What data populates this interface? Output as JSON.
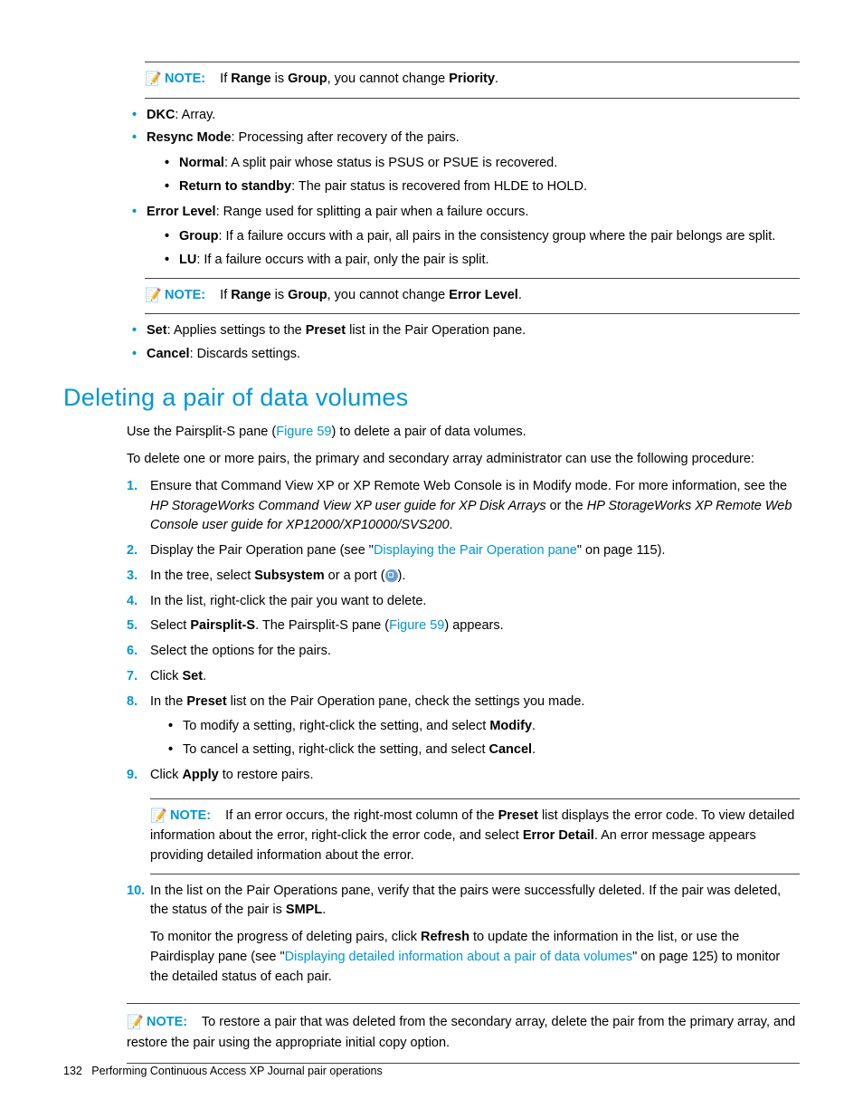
{
  "note1": {
    "label": "NOTE:",
    "pre": "If ",
    "b1": "Range",
    "mid": " is ",
    "b2": "Group",
    "post": ", you cannot change ",
    "b3": "Priority",
    "end": "."
  },
  "top_bullets": {
    "dkc": {
      "label": "DKC",
      "text": ": Array."
    },
    "resync": {
      "label": "Resync Mode",
      "text": ": Processing after recovery of the pairs."
    },
    "resync_sub": {
      "normal": {
        "label": "Normal",
        "text": ": A split pair whose status is PSUS or PSUE is recovered."
      },
      "return": {
        "label": "Return to standby",
        "text": ": The pair status is recovered from HLDE to HOLD."
      }
    },
    "error": {
      "label": "Error Level",
      "text": ": Range used for splitting a pair when a failure occurs."
    },
    "error_sub": {
      "group": {
        "label": "Group",
        "text": ": If a failure occurs with a pair, all pairs in the consistency group where the pair belongs are split."
      },
      "lu": {
        "label": "LU",
        "text": ": If a failure occurs with a pair, only the pair is split."
      }
    }
  },
  "note2": {
    "label": "NOTE:",
    "pre": "If ",
    "b1": "Range",
    "mid": " is ",
    "b2": "Group",
    "post": ", you cannot change ",
    "b3": "Error Level",
    "end": "."
  },
  "set_cancel": {
    "set": {
      "label": "Set",
      "pre": ": Applies settings to the ",
      "b": "Preset",
      "post": " list in the Pair Operation pane."
    },
    "cancel": {
      "label": "Cancel",
      "text": ": Discards settings."
    }
  },
  "heading": "Deleting a pair of data volumes",
  "intro": {
    "pre": "Use the Pairsplit-S pane (",
    "link": "Figure 59",
    "post": ") to delete a pair of data volumes."
  },
  "para2": "To delete one or more pairs, the primary and secondary array administrator can use the following procedure:",
  "steps": {
    "s1": {
      "line1": "Ensure that Command View XP or XP Remote Web Console is in Modify mode. For more information, see the ",
      "i1": "HP StorageWorks Command View XP user guide for XP Disk Arrays",
      "mid": " or the ",
      "i2": "HP StorageWorks XP Remote Web Console user guide for XP12000/XP10000/SVS200",
      "end": "."
    },
    "s2": {
      "pre": "Display the Pair Operation pane (see \"",
      "link": "Displaying the Pair Operation pane",
      "post": "\" on page 115)."
    },
    "s3": {
      "pre": "In the tree, select ",
      "b": "Subsystem",
      "mid": " or a port (",
      "post": ")."
    },
    "s4": "In the list, right-click the pair you want to delete.",
    "s5": {
      "pre": "Select ",
      "b": "Pairsplit-S",
      "mid": ". The Pairsplit-S pane (",
      "link": "Figure 59",
      "post": ") appears."
    },
    "s6": "Select the options for the pairs.",
    "s7": {
      "pre": "Click ",
      "b": "Set",
      "post": "."
    },
    "s8": {
      "pre": "In the ",
      "b": "Preset",
      "post": " list on the Pair Operation pane, check the settings you made.",
      "sub1": {
        "pre": "To modify a setting, right-click the setting, and select ",
        "b": "Modify",
        "post": "."
      },
      "sub2": {
        "pre": "To cancel a setting, right-click the setting, and select ",
        "b": "Cancel",
        "post": "."
      }
    },
    "s9": {
      "pre": "Click ",
      "b": "Apply",
      "post": " to restore pairs."
    },
    "s10": {
      "line1_pre": "In the list on the Pair Operations pane, verify that the pairs were successfully deleted. If the pair was deleted, the status of the pair is ",
      "line1_b": "SMPL",
      "line1_post": ".",
      "line2_pre": "To monitor the progress of deleting pairs, click ",
      "line2_b": "Refresh",
      "line2_mid": " to update the information in the list, or use the Pairdisplay pane (see \"",
      "line2_link": "Displaying detailed information about a pair of data volumes",
      "line2_post": "\" on page 125) to monitor the detailed status of each pair."
    }
  },
  "note3": {
    "label": "NOTE:",
    "pre": "If an error occurs, the right-most column of the ",
    "b1": "Preset",
    "mid": " list displays the error code. To view detailed information about the error, right-click the error code, and select ",
    "b2": "Error Detail",
    "post": ". An error message appears providing detailed information about the error."
  },
  "note4": {
    "label": "NOTE:",
    "text": "To restore a pair that was deleted from the secondary array, delete the pair from the primary array, and restore the pair using the appropriate initial copy option."
  },
  "footer": {
    "page": "132",
    "title": "Performing Continuous Access XP Journal pair operations"
  }
}
